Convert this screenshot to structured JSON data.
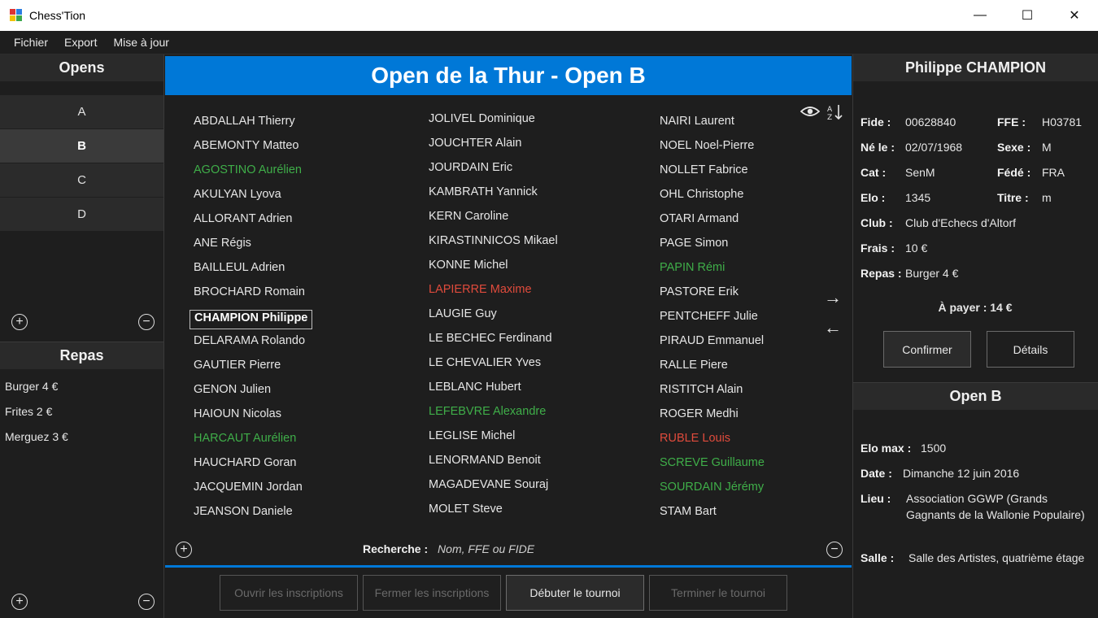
{
  "window": {
    "title": "Chess'Tion",
    "minimize": "—",
    "maximize": "☐",
    "close": "✕"
  },
  "menu": [
    "Fichier",
    "Export",
    "Mise à jour"
  ],
  "left": {
    "opens_title": "Opens",
    "opens": [
      "A",
      "B",
      "C",
      "D"
    ],
    "selected_open": "B",
    "add": "+",
    "remove": "−",
    "repas_title": "Repas",
    "repas": [
      "Burger 4 €",
      "Frites 2 €",
      "Merguez 3 €"
    ]
  },
  "center": {
    "title": "Open de la Thur - Open B",
    "columns": [
      [
        {
          "name": "ABDALLAH Thierry",
          "status": ""
        },
        {
          "name": "ABEMONTY Matteo",
          "status": ""
        },
        {
          "name": "AGOSTINO Aurélien",
          "status": "green"
        },
        {
          "name": "AKULYAN Lyova",
          "status": ""
        },
        {
          "name": "ALLORANT Adrien",
          "status": ""
        },
        {
          "name": "ANE Régis",
          "status": ""
        },
        {
          "name": "BAILLEUL Adrien",
          "status": ""
        },
        {
          "name": "BROCHARD Romain",
          "status": ""
        },
        {
          "name": "CHAMPION Philippe",
          "status": "selected"
        },
        {
          "name": "DELARAMA Rolando",
          "status": ""
        },
        {
          "name": "GAUTIER Pierre",
          "status": ""
        },
        {
          "name": "GENON Julien",
          "status": ""
        },
        {
          "name": "HAIOUN Nicolas",
          "status": ""
        },
        {
          "name": "HARCAUT Aurélien",
          "status": "green"
        },
        {
          "name": "HAUCHARD Goran",
          "status": ""
        },
        {
          "name": "JACQUEMIN Jordan",
          "status": ""
        },
        {
          "name": "JEANSON Daniele",
          "status": ""
        }
      ],
      [
        {
          "name": "JOLIVEL Dominique",
          "status": ""
        },
        {
          "name": "JOUCHTER Alain",
          "status": ""
        },
        {
          "name": "JOURDAIN Eric",
          "status": ""
        },
        {
          "name": "KAMBRATH Yannick",
          "status": ""
        },
        {
          "name": "KERN Caroline",
          "status": ""
        },
        {
          "name": "KIRASTINNICOS Mikael",
          "status": ""
        },
        {
          "name": "KONNE Michel",
          "status": ""
        },
        {
          "name": "LAPIERRE Maxime",
          "status": "red"
        },
        {
          "name": "LAUGIE Guy",
          "status": ""
        },
        {
          "name": "LE BECHEC Ferdinand",
          "status": ""
        },
        {
          "name": "LE CHEVALIER Yves",
          "status": ""
        },
        {
          "name": "LEBLANC Hubert",
          "status": ""
        },
        {
          "name": "LEFEBVRE Alexandre",
          "status": "green"
        },
        {
          "name": "LEGLISE Michel",
          "status": ""
        },
        {
          "name": "LENORMAND Benoit",
          "status": ""
        },
        {
          "name": "MAGADEVANE Souraj",
          "status": ""
        },
        {
          "name": "MOLET Steve",
          "status": ""
        }
      ],
      [
        {
          "name": "NAIRI Laurent",
          "status": ""
        },
        {
          "name": "NOEL Noel-Pierre",
          "status": ""
        },
        {
          "name": "NOLLET Fabrice",
          "status": ""
        },
        {
          "name": "OHL Christophe",
          "status": ""
        },
        {
          "name": "OTARI Armand",
          "status": ""
        },
        {
          "name": "PAGE Simon",
          "status": ""
        },
        {
          "name": "PAPIN Rémi",
          "status": "green"
        },
        {
          "name": "PASTORE Erik",
          "status": ""
        },
        {
          "name": "PENTCHEFF Julie",
          "status": ""
        },
        {
          "name": "PIRAUD Emmanuel",
          "status": ""
        },
        {
          "name": "RALLE Piere",
          "status": ""
        },
        {
          "name": "RISTITCH Alain",
          "status": ""
        },
        {
          "name": "ROGER Medhi",
          "status": ""
        },
        {
          "name": "RUBLE Louis",
          "status": "red"
        },
        {
          "name": "SCREVE Guillaume",
          "status": "green"
        },
        {
          "name": "SOURDAIN Jérémy",
          "status": "green"
        },
        {
          "name": "STAM Bart",
          "status": ""
        }
      ]
    ],
    "search_label": "Recherche :",
    "search_placeholder": "Nom, FFE ou FIDE",
    "icons": {
      "eye": "eye-icon",
      "sort": "sort-az-icon",
      "next": "→",
      "prev": "←"
    },
    "buttons": [
      {
        "label": "Ouvrir les inscriptions",
        "enabled": false
      },
      {
        "label": "Fermer les inscriptions",
        "enabled": false
      },
      {
        "label": "Débuter le tournoi",
        "enabled": true
      },
      {
        "label": "Terminer le tournoi",
        "enabled": false
      }
    ]
  },
  "player": {
    "name": "Philippe CHAMPION",
    "fide_label": "Fide :",
    "fide": "00628840",
    "ffe_label": "FFE :",
    "ffe": "H03781",
    "born_label": "Né le :",
    "born": "02/07/1968",
    "sex_label": "Sexe :",
    "sex": "M",
    "cat_label": "Cat :",
    "cat": "SenM",
    "fede_label": "Fédé :",
    "fede": "FRA",
    "elo_label": "Elo :",
    "elo": "1345",
    "title_label": "Titre :",
    "title": "m",
    "club_label": "Club :",
    "club": "Club d'Echecs d'Altorf",
    "fees_label": "Frais :",
    "fees": "10 €",
    "meal_label": "Repas :",
    "meal": "Burger 4 €",
    "to_pay": "À payer : 14 €",
    "confirm": "Confirmer",
    "details": "Détails"
  },
  "open_info": {
    "title": "Open B",
    "elo_max_label": "Elo max :",
    "elo_max": "1500",
    "date_label": "Date :",
    "date": "Dimanche 12 juin 2016",
    "place_label": "Lieu :",
    "place": "Association GGWP (Grands Gagnants de la Wallonie Populaire)",
    "room_label": "Salle :",
    "room": "Salle des Artistes, quatrième étage"
  },
  "colors": {
    "accent": "#0078d7",
    "green": "#3fae49",
    "red": "#e04b3c"
  }
}
